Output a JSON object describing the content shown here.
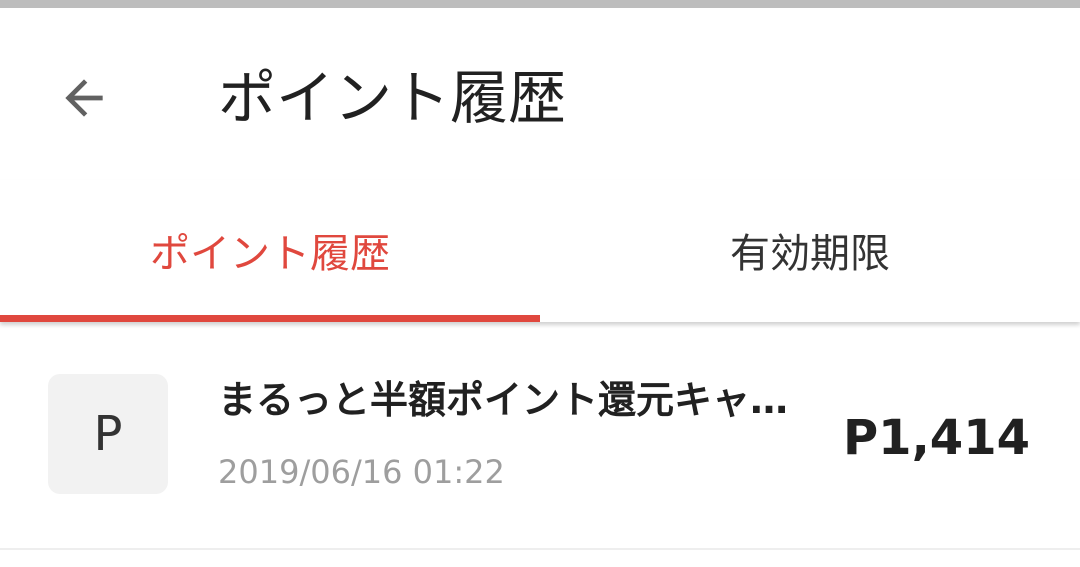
{
  "app_bar": {
    "title": "ポイント履歴",
    "back_icon": "arrow-left-icon"
  },
  "tabs": [
    {
      "label": "ポイント履歴",
      "active": true
    },
    {
      "label": "有効期限",
      "active": false
    }
  ],
  "colors": {
    "accent": "#e0483e",
    "text_primary": "#212121",
    "text_secondary": "#9e9e9e",
    "avatar_bg": "#f2f2f2"
  },
  "history": [
    {
      "avatar_letter": "P",
      "title": "まるっと半額ポイント還元キャ…",
      "date": "2019/06/16 01:22",
      "points": "P1,414"
    }
  ]
}
